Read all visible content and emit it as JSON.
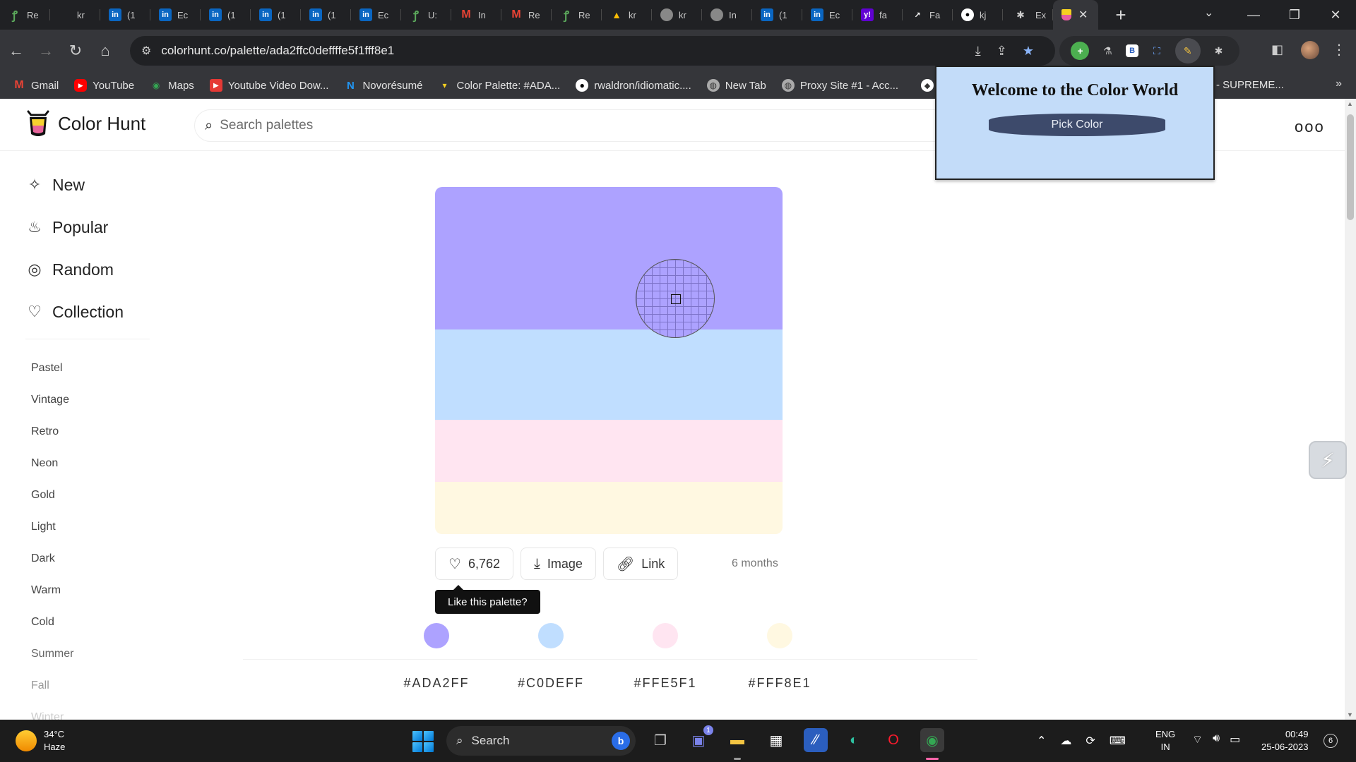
{
  "browser": {
    "tabs": [
      {
        "icon": "green-swirl-icon",
        "title": "Re"
      },
      {
        "icon": "tab-icon",
        "title": "kr"
      },
      {
        "icon": "linkedin-icon",
        "title": "(1"
      },
      {
        "icon": "linkedin-icon",
        "title": "Ec"
      },
      {
        "icon": "linkedin-icon",
        "title": "(1"
      },
      {
        "icon": "linkedin-icon",
        "title": "(1"
      },
      {
        "icon": "linkedin-icon",
        "title": "(1"
      },
      {
        "icon": "linkedin-icon",
        "title": "Ec"
      },
      {
        "icon": "green-swirl-icon",
        "title": "U:"
      },
      {
        "icon": "gmail-icon",
        "title": "In"
      },
      {
        "icon": "gmail-icon",
        "title": "Re"
      },
      {
        "icon": "green-swirl-icon",
        "title": "Re"
      },
      {
        "icon": "drive-icon",
        "title": "kr"
      },
      {
        "icon": "globe-icon",
        "title": "kr"
      },
      {
        "icon": "chatgpt-icon",
        "title": "In"
      },
      {
        "icon": "linkedin-icon",
        "title": "(1"
      },
      {
        "icon": "linkedin-icon",
        "title": "Ec"
      },
      {
        "icon": "yahoo-icon",
        "title": "fa"
      },
      {
        "icon": "chart-icon",
        "title": "Fa"
      },
      {
        "icon": "github-icon",
        "title": "kj"
      },
      {
        "icon": "puzzle-icon",
        "title": "Ex"
      }
    ],
    "active_tab": {
      "icon": "colorhunt-icon",
      "close": "✕"
    },
    "new_tab": "+",
    "url": "colorhunt.co/palette/ada2ffc0deffffe5f1fff8e1",
    "bookmarks": [
      {
        "label": "Gmail"
      },
      {
        "label": "YouTube"
      },
      {
        "label": "Maps"
      },
      {
        "label": "Youtube Video Dow..."
      },
      {
        "label": "Novorésumé"
      },
      {
        "label": "Color Palette: #ADA..."
      },
      {
        "label": "rwaldron/idiomatic...."
      },
      {
        "label": "New Tab"
      },
      {
        "label": "Proxy Site #1 - Acc..."
      },
      {
        "label": "- SUPREME..."
      }
    ]
  },
  "site": {
    "brand": "Color Hunt",
    "search_placeholder": "Search palettes",
    "main_nav": [
      {
        "label": "New",
        "icon": "sparkle-icon"
      },
      {
        "label": "Popular",
        "icon": "flame-icon"
      },
      {
        "label": "Random",
        "icon": "spiral-icon"
      },
      {
        "label": "Collection",
        "icon": "heart-icon"
      }
    ],
    "tags": [
      "Pastel",
      "Vintage",
      "Retro",
      "Neon",
      "Gold",
      "Light",
      "Dark",
      "Warm",
      "Cold",
      "Summer",
      "Fall",
      "Winter"
    ]
  },
  "palette": {
    "colors": [
      "#ADA2FF",
      "#C0DEFF",
      "#FFE5F1",
      "#FFF8E1"
    ],
    "hex_labels": [
      "#ADA2FF",
      "#C0DEFF",
      "#FFE5F1",
      "#FFF8E1"
    ],
    "likes": "6,762",
    "image_label": "Image",
    "link_label": "Link",
    "age": "6 months",
    "tooltip": "Like this palette?"
  },
  "extension_popup": {
    "title": "Welcome to the Color World",
    "button": "Pick Color"
  },
  "taskbar": {
    "weather_temp": "34°C",
    "weather_desc": "Haze",
    "search": "Search",
    "chat_badge": "1",
    "lang_1": "ENG",
    "lang_2": "IN",
    "time": "00:49",
    "date": "25-06-2023",
    "notifications": "6"
  }
}
